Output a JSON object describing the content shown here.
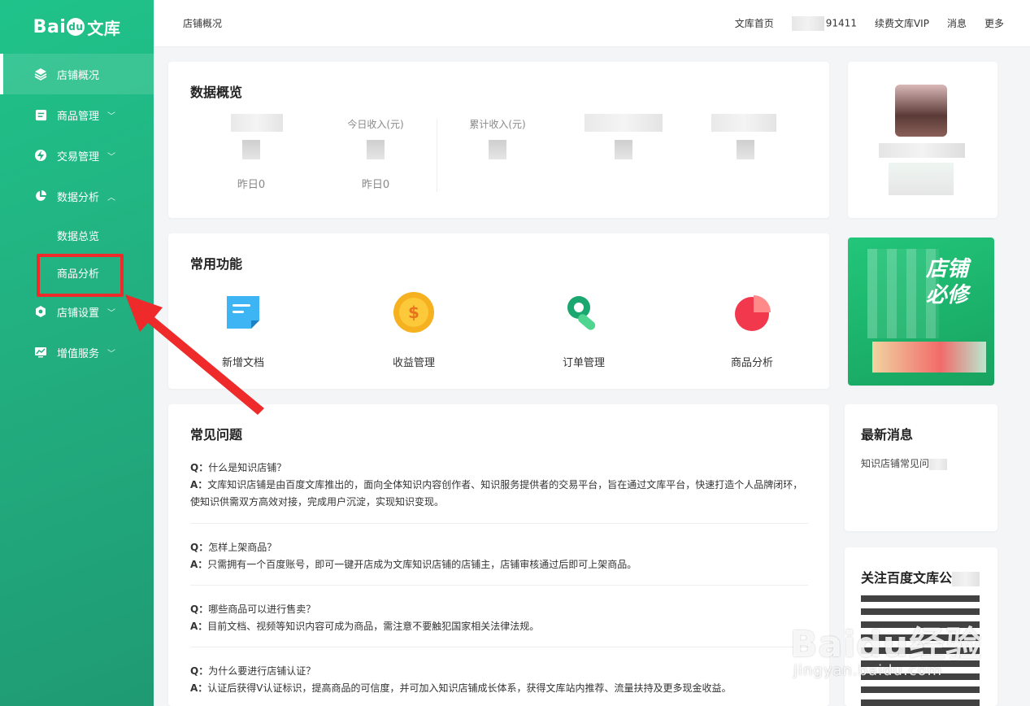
{
  "brand": {
    "bai": "Bai",
    "du": "du",
    "wenku": "文库"
  },
  "sidebar": {
    "items": [
      {
        "label": "店铺概况",
        "icon": "layers-icon",
        "active": true
      },
      {
        "label": "商品管理",
        "icon": "document-icon",
        "chevron": "down"
      },
      {
        "label": "交易管理",
        "icon": "lightning-icon",
        "chevron": "down"
      },
      {
        "label": "数据分析",
        "icon": "pie-chart-icon",
        "chevron": "up"
      },
      {
        "label": "店铺设置",
        "icon": "hexagon-gear-icon",
        "chevron": "down"
      },
      {
        "label": "增值服务",
        "icon": "chart-board-icon",
        "chevron": "down"
      }
    ],
    "sub_items": [
      {
        "label": "数据总览"
      },
      {
        "label": "商品分析"
      }
    ]
  },
  "topbar": {
    "breadcrumb": "店铺概况",
    "links": {
      "home": "文库首页",
      "user_suffix": "91411",
      "vip": "续费文库VIP",
      "messages": "消息",
      "more": "更多"
    }
  },
  "overview": {
    "title": "数据概览",
    "stats": [
      {
        "label": "",
        "yesterday": "昨日0"
      },
      {
        "label": "今日收入(元)",
        "yesterday": "昨日0"
      },
      {
        "label": "累计收入(元)",
        "yesterday": ""
      },
      {
        "label": "",
        "yesterday": ""
      },
      {
        "label": "",
        "yesterday": ""
      }
    ]
  },
  "functions": {
    "title": "常用功能",
    "items": [
      {
        "label": "新增文档",
        "icon": "new-document-icon"
      },
      {
        "label": "收益管理",
        "icon": "coin-icon"
      },
      {
        "label": "订单管理",
        "icon": "wrench-icon"
      },
      {
        "label": "商品分析",
        "icon": "pie-analysis-icon"
      }
    ]
  },
  "faq": {
    "title": "常见问题",
    "items": [
      {
        "q": "什么是知识店铺？",
        "a": "文库知识店铺是由百度文库推出的，面向全体知识内容创作者、知识服务提供者的交易平台，旨在通过文库平台，快速打造个人品牌闭环，使知识供需双方高效对接，完成用户沉淀，实现知识变现。"
      },
      {
        "q": "怎样上架商品？",
        "a": "只需拥有一个百度账号，即可一键开店成为文库知识店铺的店铺主，店铺审核通过后即可上架商品。"
      },
      {
        "q": "哪些商品可以进行售卖？",
        "a": "目前文档、视频等知识内容可成为商品，需注意不要触犯国家相关法律法规。"
      },
      {
        "q": "为什么要进行店铺认证？",
        "a": "认证后获得V认证标识，提高商品的可信度，并可加入知识店铺成长体系，获得文库站内推荐、流量扶持及更多现金收益。"
      }
    ],
    "q_prefix": "Q：",
    "a_prefix": "A："
  },
  "right": {
    "banner_text_1": "店铺",
    "banner_text_2": "必修",
    "news_title": "最新消息",
    "news_item": "知识店铺常见问",
    "follow_title": "关注百度文库公"
  },
  "watermark": {
    "main": "Baidu经验",
    "sub": "jingyan.baidu.com"
  },
  "colors": {
    "sidebar": "#1fb884",
    "accent_red": "#ee2a2a",
    "banner": "#1fbf73"
  }
}
